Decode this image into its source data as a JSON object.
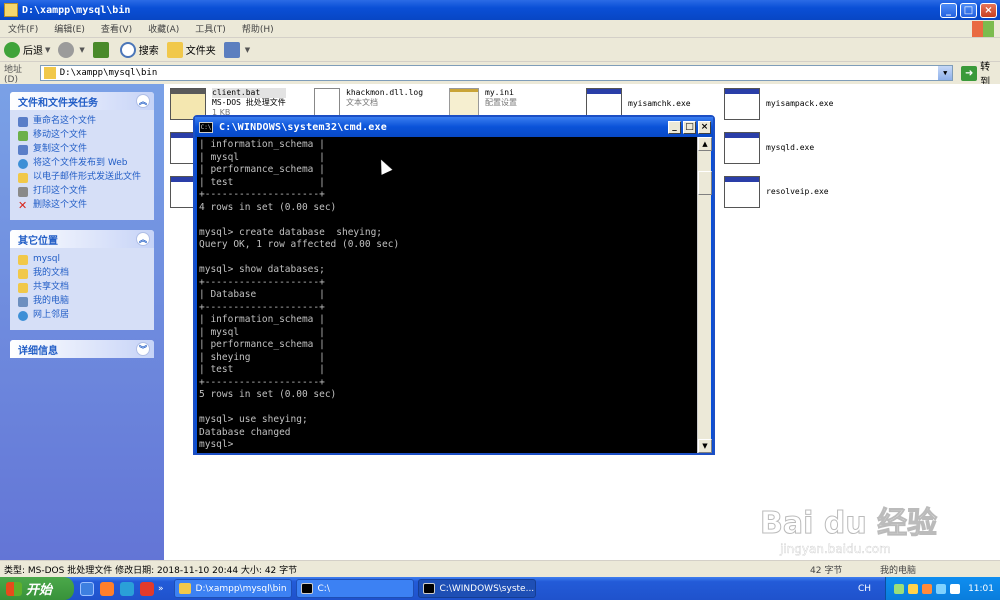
{
  "window": {
    "title": "D:\\xampp\\mysql\\bin",
    "controls": [
      "_",
      "□",
      "×"
    ]
  },
  "menu": [
    "文件(F)",
    "编辑(E)",
    "查看(V)",
    "收藏(A)",
    "工具(T)",
    "帮助(H)"
  ],
  "toolbar": {
    "back": "后退",
    "search": "搜索",
    "folders": "文件夹"
  },
  "address": {
    "label": "地址(D)",
    "value": "D:\\xampp\\mysql\\bin",
    "go": "转到"
  },
  "tasks_panel": {
    "title": "文件和文件夹任务",
    "items": [
      "重命名这个文件",
      "移动这个文件",
      "复制这个文件",
      "将这个文件发布到 Web",
      "以电子邮件形式发送此文件",
      "打印这个文件",
      "删除这个文件"
    ]
  },
  "places_panel": {
    "title": "其它位置",
    "items": [
      "mysql",
      "我的文档",
      "共享文档",
      "我的电脑",
      "网上邻居"
    ]
  },
  "details_panel": {
    "title": "详细信息"
  },
  "files": [
    {
      "name": "client.bat",
      "type": "MS-DOS 批处理文件",
      "extra": "1 KB"
    },
    {
      "name": "khackmon.dll.log",
      "type": "文本文档",
      "extra": ""
    },
    {
      "name": "my.ini",
      "type": "配置设置",
      "extra": ""
    },
    {
      "name": "myisamchk.exe",
      "type": "",
      "extra": ""
    },
    {
      "name": "myisampack.exe",
      "type": "",
      "extra": ""
    },
    {
      "name": "mysqld.exe",
      "type": "",
      "extra": ""
    },
    {
      "name": "resolveip.exe",
      "type": "",
      "extra": ""
    }
  ],
  "cmd": {
    "title": "C:\\WINDOWS\\system32\\cmd.exe",
    "icon": "C:\\",
    "output": "| information_schema |\n| mysql              |\n| performance_schema |\n| test               |\n+--------------------+\n4 rows in set (0.00 sec)\n\nmysql> create database  sheying;\nQuery OK, 1 row affected (0.00 sec)\n\nmysql> show databases;\n+--------------------+\n| Database           |\n+--------------------+\n| information_schema |\n| mysql              |\n| performance_schema |\n| sheying            |\n| test               |\n+--------------------+\n5 rows in set (0.00 sec)\n\nmysql> use sheying;\nDatabase changed\nmysql>"
  },
  "statusbar": {
    "text": "类型: MS-DOS 批处理文件 修改日期: 2018-11-10 20:44 大小: 42 字节",
    "size": "42 字节",
    "zone": "我的电脑"
  },
  "taskbar": {
    "start": "开始",
    "tasks": [
      "D:\\xampp\\mysql\\bin",
      "C:\\",
      "C:\\WINDOWS\\syste..."
    ],
    "lang": "CH",
    "clock": "11:01"
  },
  "watermark": {
    "brand": "Bai du 经验",
    "sub": "jingyan.baidu.com"
  }
}
